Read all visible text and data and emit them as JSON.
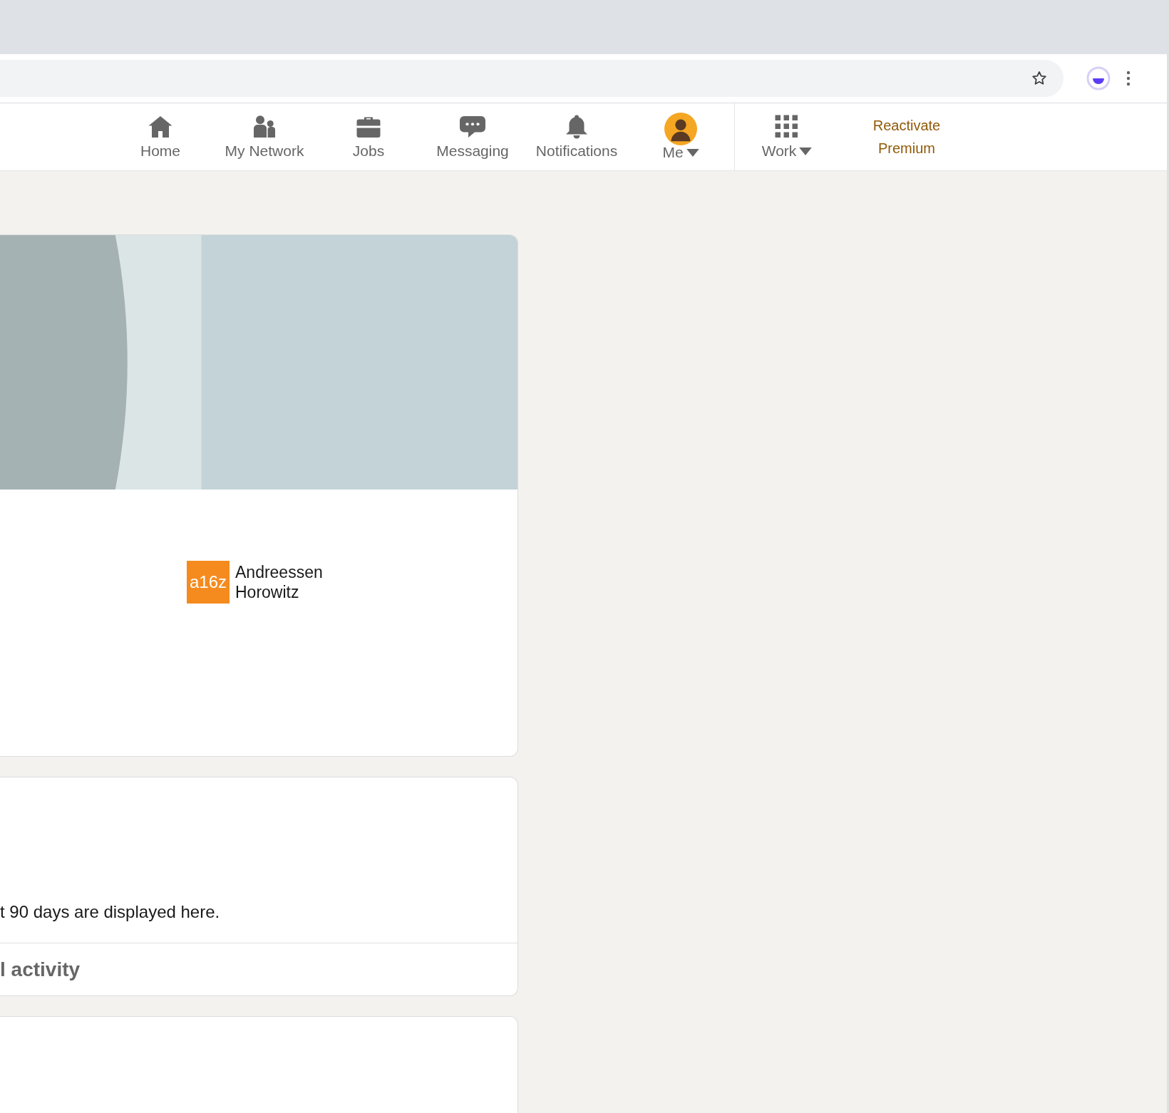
{
  "nav": {
    "items": [
      {
        "label": "Home",
        "kind": "home",
        "dropdown": false
      },
      {
        "label": "My Network",
        "kind": "network",
        "dropdown": false
      },
      {
        "label": "Jobs",
        "kind": "jobs",
        "dropdown": false
      },
      {
        "label": "Messaging",
        "kind": "messaging",
        "dropdown": false
      },
      {
        "label": "Notifications",
        "kind": "notifications",
        "dropdown": false
      },
      {
        "label": "Me",
        "kind": "avatar",
        "dropdown": true
      }
    ],
    "work": {
      "label": "Work",
      "dropdown": true
    },
    "premium_link": "Reactivate Premium"
  },
  "profile_card": {
    "company": {
      "logo_text": "a16z",
      "name": "Andreessen Horowitz"
    }
  },
  "activity_card": {
    "text": "t 90 days are displayed here.",
    "footer_link": "l activity"
  }
}
